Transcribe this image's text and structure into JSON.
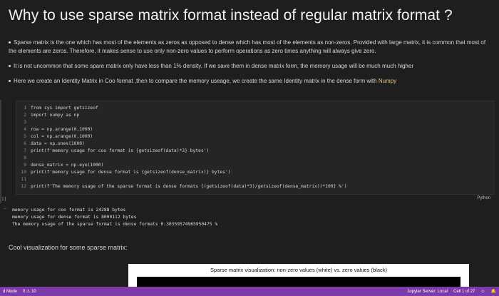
{
  "title": "Why to use sparse matrix format instead of regular matrix format ?",
  "bullets": [
    "Sparse matrix is the one which has most of the elements as zeros as opposed to dense which has most of the elements as non-zeros. Provided with large matrix, it is common that most of the elements are zeros. Therefore, it makes sense to use only non-zero values to perform operations as zero times anything will always give zero.",
    "It is not uncommon that some spare matrix only have less than 1% density. If we save them in dense matrix form, the memory usage will be much much higher",
    "Here we create an Identity Matrix in Coo format ,then to compare the memory useage, we create the same Identity matrix in the dense form with"
  ],
  "numpy_highlight": "Numpy",
  "code_lines": [
    {
      "n": "1",
      "text": "from sys import getsizeof"
    },
    {
      "n": "2",
      "text": "import numpy as np"
    },
    {
      "n": "3",
      "text": ""
    },
    {
      "n": "4",
      "text": "row = np.arange(0,1000)"
    },
    {
      "n": "5",
      "text": "col = np.arange(0,1000)"
    },
    {
      "n": "6",
      "text": "data = np.ones(1000)"
    },
    {
      "n": "7",
      "text": "print(f'memory usage for  coo format is {getsizeof(data)*3} bytes')"
    },
    {
      "n": "8",
      "text": ""
    },
    {
      "n": "9",
      "text": "dense_matrix = np.eye(1000)"
    },
    {
      "n": "10",
      "text": "print(f'memory usage for dense format is {getsizeof(dense_matrix)} bytes')"
    },
    {
      "n": "11",
      "text": ""
    },
    {
      "n": "12",
      "text": "print(f'The memory usage of the sparse format is dense formats {(getsizeof(data)*3)/getsizeof(dense_matrix))*100} %')"
    }
  ],
  "exec_count": "1]",
  "language": "Python",
  "output_lines": [
    "memory usage for  coo format is 24288 bytes",
    "memory usage for dense format is 8000112 bytes",
    "The memory usage of the sparse format is dense formats 0.30359574965950475 %"
  ],
  "cool_text": "Cool visualization for some sparse matrix:",
  "figure_title": "Sparse matrix visualization: non-zero values (white) vs. zero values (black)",
  "status": {
    "mode": "d Mode",
    "problems": "0 ⚠ 10",
    "server": "Jupyter Server: Local",
    "cell": "Cell 1 of 27"
  },
  "colors": {
    "statusbar": "#7c3aa8",
    "background": "#1e1e1e"
  }
}
